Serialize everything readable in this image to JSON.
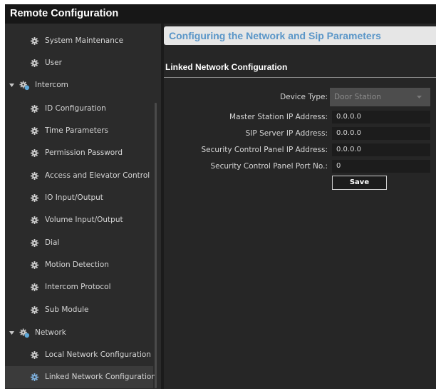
{
  "window": {
    "title": "Remote Configuration"
  },
  "sidebar": {
    "items": [
      {
        "label": "System Maintenance"
      },
      {
        "label": "User"
      },
      {
        "label": "Intercom"
      },
      {
        "label": "ID Configuration"
      },
      {
        "label": "Time Parameters"
      },
      {
        "label": "Permission Password"
      },
      {
        "label": "Access and Elevator Control"
      },
      {
        "label": "IO Input/Output"
      },
      {
        "label": "Volume Input/Output"
      },
      {
        "label": "Dial"
      },
      {
        "label": "Motion Detection"
      },
      {
        "label": "Intercom Protocol"
      },
      {
        "label": "Sub Module"
      },
      {
        "label": "Network"
      },
      {
        "label": "Local Network Configuration"
      },
      {
        "label": "Linked Network Configuration",
        "selected": true
      }
    ]
  },
  "main": {
    "header": "Configuring the Network and Sip Parameters",
    "section_title": "Linked Network Configuration",
    "device_type": {
      "label": "Device Type:",
      "value": "Door Station"
    },
    "master_ip": {
      "label": "Master Station IP Address:",
      "value": "0.0.0.0"
    },
    "sip_ip": {
      "label": "SIP Server IP Address:",
      "value": "0.0.0.0"
    },
    "security_ip": {
      "label": "Security Control Panel IP Address:",
      "value": "0.0.0.0"
    },
    "security_port": {
      "label": "Security Control Panel Port No.:",
      "value": "0"
    },
    "save_label": "Save"
  },
  "colors": {
    "accent_text": "#5a96c8",
    "background": "#262626",
    "banner": "#e6e6e6"
  },
  "icons": [
    "gear-icon",
    "network-icon",
    "chevron-down-icon"
  ]
}
